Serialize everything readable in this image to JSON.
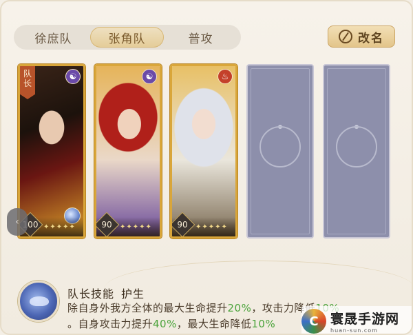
{
  "tabs": [
    {
      "label": "徐庶队",
      "active": false
    },
    {
      "label": "张角队",
      "active": true
    },
    {
      "label": "普攻",
      "active": false
    }
  ],
  "rename_label": "改名",
  "cards": [
    {
      "filled": true,
      "leader_tag": "队长",
      "faction": "purple",
      "level": "100",
      "stars": "✦✦✦✦✦"
    },
    {
      "filled": true,
      "leader_tag": "",
      "faction": "purple",
      "level": "90",
      "stars": "✦✦✦✦✦"
    },
    {
      "filled": true,
      "leader_tag": "",
      "faction": "fire",
      "level": "90",
      "stars": "✦✦✦✦✦"
    },
    {
      "filled": false
    },
    {
      "filled": false
    }
  ],
  "skill": {
    "title": "队长技能",
    "name": "护生",
    "line1_a": "除自身外我方全体的最大生命提升",
    "line1_b": "20%",
    "line1_c": "，攻击力降低",
    "line1_d": "10%",
    "line2_a": "。自身攻击力提升",
    "line2_b": "40%",
    "line2_c": "，最大生命降低",
    "line2_d": "10%"
  },
  "watermark": {
    "name": "寰晟手游网",
    "url": "huan-sun.com"
  },
  "colors": {
    "accent": "#d9a63a",
    "highlight": "#4aa33a",
    "empty_slot": "#8d8fab"
  }
}
